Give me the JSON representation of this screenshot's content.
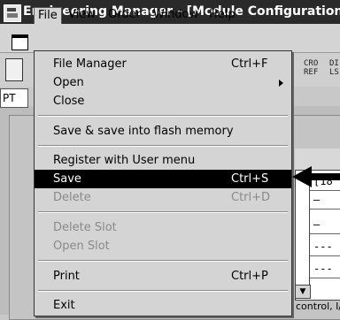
{
  "window": {
    "title": "Engineering Manager - [Module Configuration   N"
  },
  "menubar": {
    "items": [
      "File",
      "View",
      "Order",
      "Window",
      "Help"
    ]
  },
  "toolbar": {
    "labels": [
      "CRO",
      "REF",
      "DI",
      "LS"
    ]
  },
  "tab": {
    "label": "PT"
  },
  "grid": {
    "rows": [
      "[18",
      "–",
      "–",
      "---",
      "---"
    ]
  },
  "status": {
    "text": "control, I/"
  },
  "file_menu": {
    "items": [
      {
        "label": "File Manager",
        "shortcut": "Ctrl+F",
        "state": "enabled"
      },
      {
        "label": "Open",
        "shortcut": "",
        "state": "enabled",
        "submenu": true
      },
      {
        "label": "Close",
        "shortcut": "",
        "state": "enabled"
      },
      {
        "label": "Save & save into flash memory",
        "shortcut": "",
        "state": "enabled"
      },
      {
        "label": "Register with User menu",
        "shortcut": "",
        "state": "enabled"
      },
      {
        "label": "Save",
        "shortcut": "Ctrl+S",
        "state": "selected"
      },
      {
        "label": "Delete",
        "shortcut": "Ctrl+D",
        "state": "disabled"
      },
      {
        "label": "Delete Slot",
        "shortcut": "",
        "state": "disabled"
      },
      {
        "label": "Open Slot",
        "shortcut": "",
        "state": "disabled"
      },
      {
        "label": "Print",
        "shortcut": "Ctrl+P",
        "state": "enabled"
      },
      {
        "label": "Exit",
        "shortcut": "",
        "state": "enabled"
      }
    ]
  },
  "colors": {
    "selection_bg": "#000000",
    "disabled_text": "#8a8a8a",
    "titlebar_bg": "#2a2a2a"
  }
}
